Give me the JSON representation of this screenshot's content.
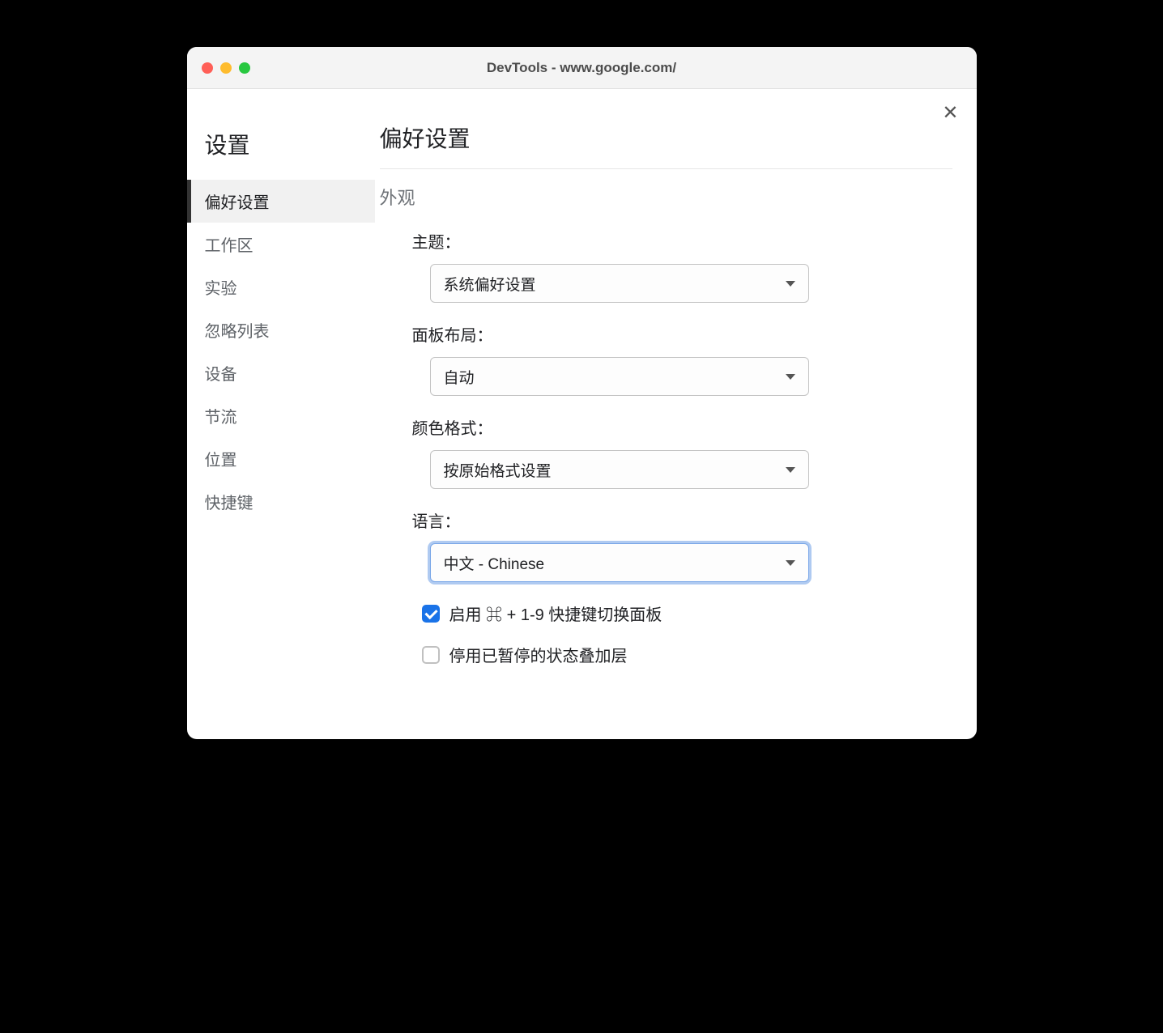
{
  "window": {
    "title": "DevTools - www.google.com/"
  },
  "sidebar": {
    "title": "设置",
    "items": [
      {
        "label": "偏好设置",
        "active": true
      },
      {
        "label": "工作区",
        "active": false
      },
      {
        "label": "实验",
        "active": false
      },
      {
        "label": "忽略列表",
        "active": false
      },
      {
        "label": "设备",
        "active": false
      },
      {
        "label": "节流",
        "active": false
      },
      {
        "label": "位置",
        "active": false
      },
      {
        "label": "快捷键",
        "active": false
      }
    ]
  },
  "main": {
    "title": "偏好设置",
    "section": "外观",
    "fields": {
      "theme": {
        "label": "主题：",
        "value": "系统偏好设置"
      },
      "layout": {
        "label": "面板布局：",
        "value": "自动"
      },
      "colorFormat": {
        "label": "颜色格式：",
        "value": "按原始格式设置"
      },
      "language": {
        "label": "语言：",
        "value": "中文 - Chinese"
      }
    },
    "checkboxes": {
      "shortcut": {
        "label": "启用 ⌘ + 1-9 快捷键切换面板",
        "checked": true
      },
      "overlay": {
        "label": "停用已暂停的状态叠加层",
        "checked": false
      }
    }
  }
}
